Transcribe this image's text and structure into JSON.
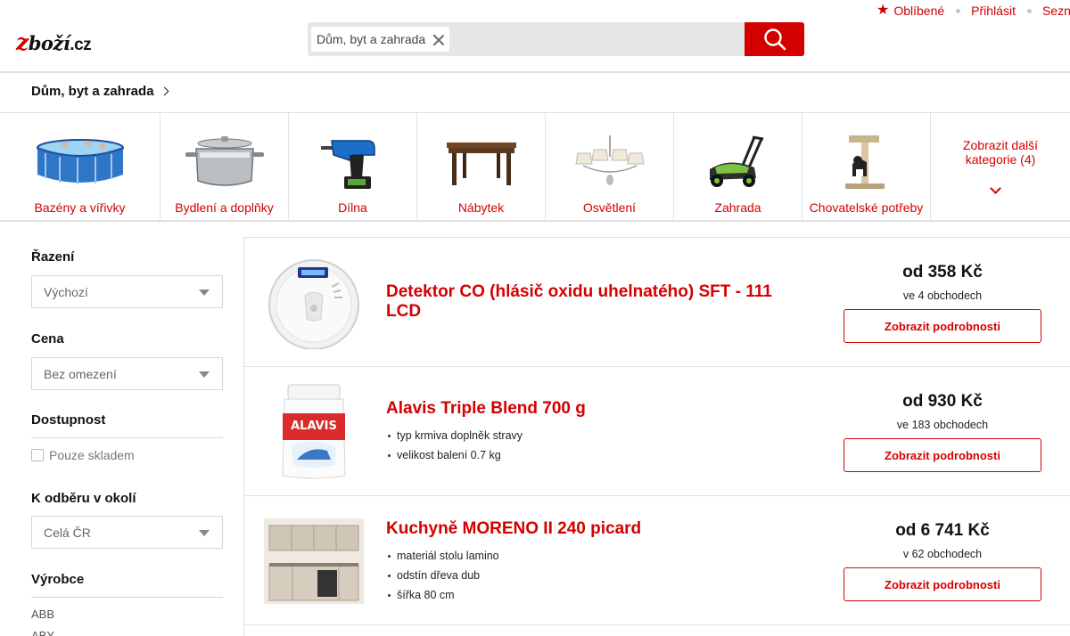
{
  "top_links": {
    "favorites": "Oblíbené",
    "login": "Přihlásit",
    "seznam": "Seznam"
  },
  "logo": {
    "z": "z",
    "rest": "boží",
    "tld": ".cz"
  },
  "search": {
    "chip": "Dům, byt a zahrada",
    "button_icon": "search-icon"
  },
  "breadcrumb": "Dům, byt a zahrada",
  "categories": [
    {
      "label": "Bazény a vířivky",
      "icon": "pool-image"
    },
    {
      "label": "Bydlení a doplňky",
      "icon": "pot-image"
    },
    {
      "label": "Dílna",
      "icon": "drill-image"
    },
    {
      "label": "Nábytek",
      "icon": "table-image"
    },
    {
      "label": "Osvětlení",
      "icon": "chandelier-image"
    },
    {
      "label": "Zahrada",
      "icon": "lawnmower-image"
    },
    {
      "label": "Chovatelské potřeby",
      "icon": "cat-tree-image"
    }
  ],
  "more_categories": {
    "line1": "Zobrazit další",
    "line2": "kategorie (4)"
  },
  "filters": {
    "sort": {
      "label": "Řazení",
      "value": "Výchozí"
    },
    "price": {
      "label": "Cena",
      "value": "Bez omezení"
    },
    "availability": {
      "label": "Dostupnost",
      "checkbox": "Pouze skladem"
    },
    "pickup": {
      "label": "K odběru v okolí",
      "value": "Celá ČR"
    },
    "manufacturer": {
      "label": "Výrobce",
      "items": [
        "ABB",
        "ABY"
      ]
    }
  },
  "products": [
    {
      "title": "Detektor CO (hlásič oxidu uhelnatého) SFT - 111 LCD",
      "params": [],
      "price": "od 358 Kč",
      "shops": "ve 4 obchodech",
      "button": "Zobrazit podrobnosti"
    },
    {
      "title": "Alavis Triple Blend 700 g",
      "params": [
        "typ krmiva doplněk stravy",
        "velikost balení 0.7 kg"
      ],
      "price": "od 930 Kč",
      "shops": "ve 183 obchodech",
      "button": "Zobrazit podrobnosti",
      "label_text": "ALAVIS"
    },
    {
      "title": "Kuchyně MORENO II 240 picard",
      "params": [
        "materiál stolu lamino",
        "odstín dřeva dub",
        "šířka 80 cm"
      ],
      "price": "od 6 741 Kč",
      "shops": "v 62 obchodech",
      "button": "Zobrazit podrobnosti"
    }
  ],
  "colors": {
    "accent": "#d40000",
    "border": "#e0e0e0"
  }
}
